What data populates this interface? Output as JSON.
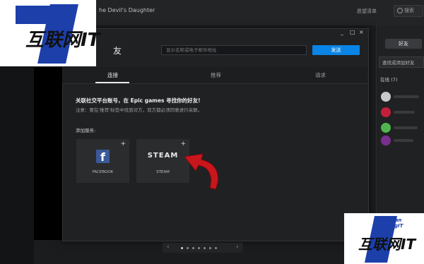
{
  "topbar": {
    "title": "he Devil's Daughter",
    "wishlist": "愿望清单",
    "search_placeholder": "搜索"
  },
  "dialog": {
    "title": "友",
    "search_placeholder": "显示名称或电子邮件地址",
    "send_label": "发送",
    "tabs": [
      "连接",
      "推荐",
      "请求"
    ],
    "heading": "关联社交平台账号，在 Epic games 寻找你的好友!",
    "notice": "注意：要在'推荐'标签中找到对方，双方都必须同意进行关联。",
    "add_label": "添加服务:",
    "services": [
      {
        "name": "FACEBOOK",
        "icon": "facebook-logo"
      },
      {
        "name": "STEAM",
        "logo_text": "STEAM"
      }
    ],
    "window_controls": [
      "_",
      "□",
      "×"
    ]
  },
  "friends_panel": {
    "add_friend": "好友",
    "search_placeholder": "查找或添加好友",
    "online_label": "在线 (7)",
    "avatar_colors": [
      "#c9c9c9",
      "#c41f3a",
      "#4fb64f",
      "#2b2c2e",
      "#7a2f8f"
    ]
  },
  "watermark": {
    "line1": "HuLian",
    "line2": "WangIT",
    "brand": "互联网IT"
  },
  "colors": {
    "accent": "#0a84e5",
    "highlight_arrow": "#c8161d",
    "watermark_blue": "#1c3faa"
  },
  "pager": {
    "active_index": 0,
    "count": 7
  }
}
